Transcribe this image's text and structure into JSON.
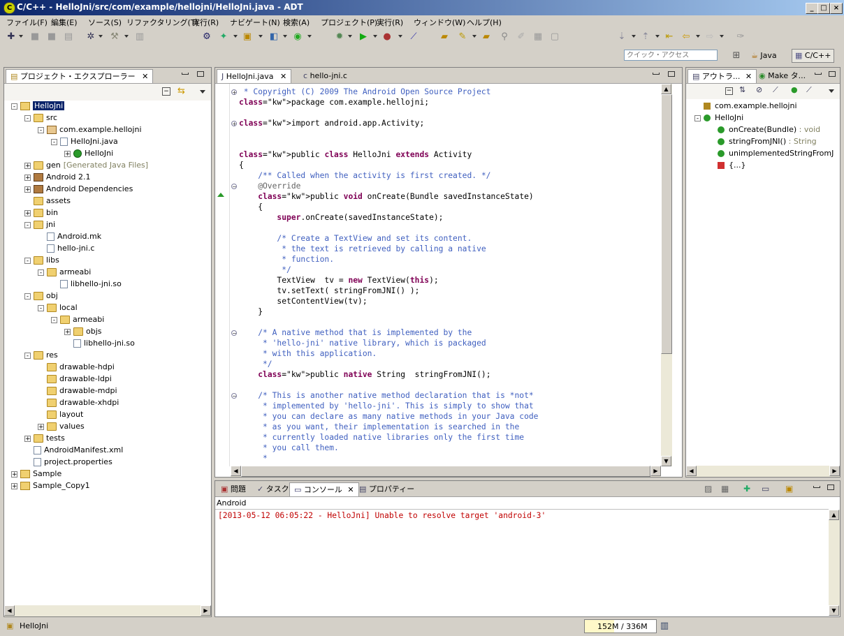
{
  "window": {
    "title": "C/C++ - HelloJni/src/com/example/hellojni/HelloJni.java - ADT",
    "icon_letter": "C"
  },
  "menu": [
    "ファイル(F)",
    "編集(E)",
    "ソース(S)",
    "リファクタリング(T)",
    "実行(R)",
    "ナビゲート(N)",
    "検索(A)",
    "プロジェクト(P)",
    "実行(R)",
    "ウィンドウ(W)",
    "ヘルプ(H)"
  ],
  "quick_access": {
    "placeholder": "クイック・アクセス"
  },
  "perspectives": {
    "java": "Java",
    "cpp": "C/C++"
  },
  "explorer": {
    "tab": "プロジェクト・エクスプローラー",
    "tree": [
      {
        "label": "HelloJni",
        "icon": "project",
        "depth": 0,
        "exp": "-",
        "selected": true
      },
      {
        "label": "src",
        "icon": "folder",
        "depth": 1,
        "exp": "-"
      },
      {
        "label": "com.example.hellojni",
        "icon": "package",
        "depth": 2,
        "exp": "-"
      },
      {
        "label": "HelloJni.java",
        "icon": "java-file",
        "depth": 3,
        "exp": "-"
      },
      {
        "label": "HelloJni",
        "icon": "class",
        "depth": 4,
        "exp": "+"
      },
      {
        "label": "gen",
        "icon": "folder",
        "depth": 1,
        "exp": "+",
        "extra": "[Generated Java Files]"
      },
      {
        "label": "Android 2.1",
        "icon": "library",
        "depth": 1,
        "exp": "+"
      },
      {
        "label": "Android Dependencies",
        "icon": "library",
        "depth": 1,
        "exp": "+"
      },
      {
        "label": "assets",
        "icon": "folder",
        "depth": 1,
        "exp": ""
      },
      {
        "label": "bin",
        "icon": "folder",
        "depth": 1,
        "exp": "+"
      },
      {
        "label": "jni",
        "icon": "folder",
        "depth": 1,
        "exp": "-"
      },
      {
        "label": "Android.mk",
        "icon": "file",
        "depth": 2,
        "exp": ""
      },
      {
        "label": "hello-jni.c",
        "icon": "c-file",
        "depth": 2,
        "exp": ""
      },
      {
        "label": "libs",
        "icon": "folder",
        "depth": 1,
        "exp": "-"
      },
      {
        "label": "armeabi",
        "icon": "folder",
        "depth": 2,
        "exp": "-"
      },
      {
        "label": "libhello-jni.so",
        "icon": "binary-file",
        "depth": 3,
        "exp": ""
      },
      {
        "label": "obj",
        "icon": "folder",
        "depth": 1,
        "exp": "-"
      },
      {
        "label": "local",
        "icon": "folder",
        "depth": 2,
        "exp": "-"
      },
      {
        "label": "armeabi",
        "icon": "folder",
        "depth": 3,
        "exp": "-"
      },
      {
        "label": "objs",
        "icon": "folder",
        "depth": 4,
        "exp": "+"
      },
      {
        "label": "libhello-jni.so",
        "icon": "binary-file",
        "depth": 4,
        "exp": ""
      },
      {
        "label": "res",
        "icon": "folder",
        "depth": 1,
        "exp": "-"
      },
      {
        "label": "drawable-hdpi",
        "icon": "folder",
        "depth": 2,
        "exp": ""
      },
      {
        "label": "drawable-ldpi",
        "icon": "folder",
        "depth": 2,
        "exp": ""
      },
      {
        "label": "drawable-mdpi",
        "icon": "folder",
        "depth": 2,
        "exp": ""
      },
      {
        "label": "drawable-xhdpi",
        "icon": "folder",
        "depth": 2,
        "exp": ""
      },
      {
        "label": "layout",
        "icon": "folder",
        "depth": 2,
        "exp": ""
      },
      {
        "label": "values",
        "icon": "folder",
        "depth": 2,
        "exp": "+"
      },
      {
        "label": "tests",
        "icon": "folder",
        "depth": 1,
        "exp": "+"
      },
      {
        "label": "AndroidManifest.xml",
        "icon": "xml-file",
        "depth": 1,
        "exp": ""
      },
      {
        "label": "project.properties",
        "icon": "file",
        "depth": 1,
        "exp": ""
      },
      {
        "label": "Sample",
        "icon": "project",
        "depth": 0,
        "exp": "+"
      },
      {
        "label": "Sample_Copy1",
        "icon": "project",
        "depth": 0,
        "exp": "+"
      }
    ]
  },
  "editor": {
    "tabs": [
      {
        "label": "HelloJni.java",
        "active": true
      },
      {
        "label": "hello-jni.c",
        "active": false
      }
    ],
    "lines": [
      {
        "t": "cm",
        "g": "+",
        "s": " * Copyright (C) 2009 The Android Open Source Project"
      },
      {
        "t": "code",
        "s": "package com.example.hellojni;"
      },
      {
        "t": "blank",
        "s": ""
      },
      {
        "t": "code",
        "g": "+",
        "s": "import android.app.Activity;"
      },
      {
        "t": "blank",
        "s": ""
      },
      {
        "t": "blank",
        "s": ""
      },
      {
        "t": "code",
        "s": "public class HelloJni extends Activity"
      },
      {
        "t": "code",
        "s": "{"
      },
      {
        "t": "cm",
        "s": "    /** Called when the activity is first created. */"
      },
      {
        "t": "an",
        "g": "-",
        "s": "    @Override"
      },
      {
        "t": "code",
        "s": "    public void onCreate(Bundle savedInstanceState)"
      },
      {
        "t": "code",
        "s": "    {"
      },
      {
        "t": "code",
        "s": "        super.onCreate(savedInstanceState);"
      },
      {
        "t": "blank",
        "s": ""
      },
      {
        "t": "cm2",
        "s": "        /* Create a TextView and set its content."
      },
      {
        "t": "cm2",
        "s": "         * the text is retrieved by calling a native"
      },
      {
        "t": "cm2",
        "s": "         * function."
      },
      {
        "t": "cm2",
        "s": "         */"
      },
      {
        "t": "code",
        "s": "        TextView  tv = new TextView(this);"
      },
      {
        "t": "code",
        "s": "        tv.setText( stringFromJNI() );"
      },
      {
        "t": "code",
        "s": "        setContentView(tv);"
      },
      {
        "t": "code",
        "s": "    }"
      },
      {
        "t": "blank",
        "s": ""
      },
      {
        "t": "cm2",
        "g": "-",
        "s": "    /* A native method that is implemented by the"
      },
      {
        "t": "cm2",
        "s": "     * 'hello-jni' native library, which is packaged"
      },
      {
        "t": "cm2",
        "s": "     * with this application."
      },
      {
        "t": "cm2",
        "s": "     */"
      },
      {
        "t": "code",
        "s": "    public native String  stringFromJNI();"
      },
      {
        "t": "blank",
        "s": ""
      },
      {
        "t": "cm2",
        "g": "-",
        "s": "    /* This is another native method declaration that is *not*"
      },
      {
        "t": "cm2",
        "s": "     * implemented by 'hello-jni'. This is simply to show that"
      },
      {
        "t": "cm2",
        "s": "     * you can declare as many native methods in your Java code"
      },
      {
        "t": "cm2",
        "s": "     * as you want, their implementation is searched in the"
      },
      {
        "t": "cm2",
        "s": "     * currently loaded native libraries only the first time"
      },
      {
        "t": "cm2",
        "s": "     * you call them."
      },
      {
        "t": "cm2",
        "s": "     *"
      }
    ]
  },
  "outline": {
    "tabs": [
      "アウトラ...",
      "Make タ..."
    ],
    "items": [
      {
        "label": "com.example.hellojni",
        "icon": "package",
        "depth": 0
      },
      {
        "label": "HelloJni",
        "icon": "class",
        "depth": 0,
        "exp": "-"
      },
      {
        "label": "onCreate(Bundle)",
        "suffix": " : void",
        "icon": "method-public",
        "depth": 1
      },
      {
        "label": "stringFromJNI()",
        "suffix": " : String",
        "icon": "method-native",
        "depth": 1
      },
      {
        "label": "unimplementedStringFromJ",
        "suffix": "",
        "icon": "method-native",
        "depth": 1
      },
      {
        "label": "{...}",
        "suffix": "",
        "icon": "static-block",
        "depth": 1
      }
    ]
  },
  "console": {
    "tabs": [
      "問題",
      "タスク",
      "コンソール",
      "プロパティー"
    ],
    "active": 2,
    "header": "Android",
    "lines": [
      "[2013-05-12 06:05:22 - HelloJni] Unable to resolve target 'android-3'"
    ],
    "error_color": "#c00000"
  },
  "status": {
    "left": "HelloJni",
    "heap": "152M / 336M"
  },
  "colors": {
    "title_from": "#0a246a",
    "title_to": "#a6caf0",
    "keyword": "#7f0055",
    "javadoc": "#3f5fbf",
    "comment": "#3f7f5f"
  }
}
